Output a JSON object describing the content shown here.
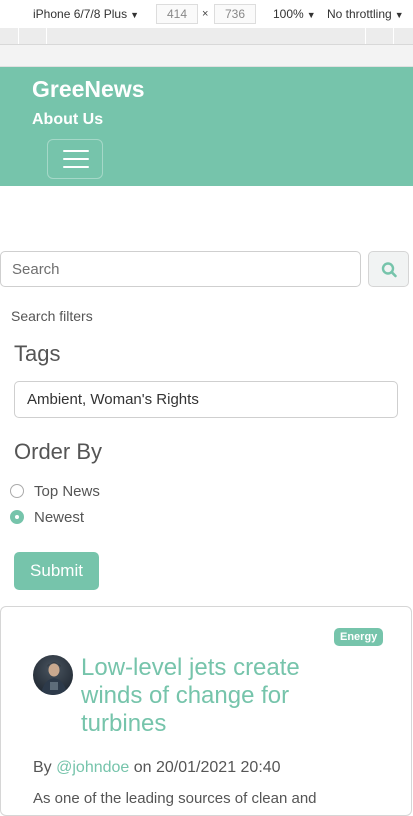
{
  "devtools": {
    "device": "iPhone 6/7/8 Plus",
    "width": "414",
    "height": "736",
    "times": "×",
    "zoom": "100%",
    "throttling": "No throttling"
  },
  "navbar": {
    "brand": "GreeNews",
    "about": "About Us"
  },
  "search": {
    "placeholder": "Search"
  },
  "filters": {
    "label": "Search filters",
    "tags_heading": "Tags",
    "tags_value": "Ambient, Woman's Rights",
    "order_heading": "Order By",
    "options": [
      {
        "label": "Top News",
        "checked": false
      },
      {
        "label": "Newest",
        "checked": true
      }
    ],
    "submit_label": "Submit"
  },
  "article": {
    "badge": "Energy",
    "title": "Low-level jets create winds of change for turbines",
    "by": "By",
    "author": "@johndoe",
    "on": "on 20/01/2021 20:40",
    "excerpt": "As one of the leading sources of clean and"
  },
  "colors": {
    "accent": "#76c4ab"
  }
}
